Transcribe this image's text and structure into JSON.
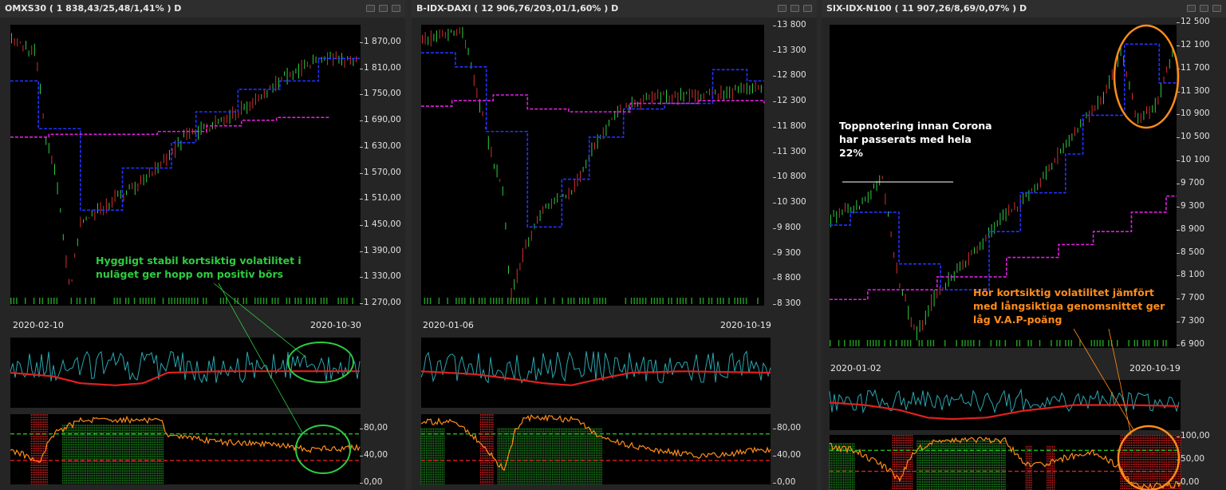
{
  "panes": [
    {
      "title": "OMXS30 ( 1 838,43/25,48/1,41% )  D",
      "price_axis": [
        "1 870,00",
        "1 810,00",
        "1 750,00",
        "1 690,00",
        "1 630,00",
        "1 570,00",
        "1 510,00",
        "1 450,00",
        "1 390,00",
        "1 330,00",
        "1 270,00"
      ],
      "date_start": "2020-02-10",
      "date_end": "2020-10-30",
      "osc_axis": [
        "80,00",
        "40,00",
        "0,00"
      ],
      "annotation": "Hyggligt stabil kortsiktig volatilitet i nuläget ger hopp om positiv börs"
    },
    {
      "title": "B-IDX-DAXI ( 12 906,76/203,01/1,60% )  D",
      "price_axis": [
        "13 800",
        "13 300",
        "12 800",
        "12 300",
        "11 800",
        "11 300",
        "10 800",
        "10 300",
        "9 800",
        "9 300",
        "8 800",
        "8 300"
      ],
      "date_start": "2020-01-06",
      "date_end": "2020-10-19",
      "osc_axis": [
        "80,00",
        "40,00",
        "0,00"
      ]
    },
    {
      "title": "SIX-IDX-N100 ( 11 907,26/8,69/0,07% )  D",
      "price_axis": [
        "12 500",
        "12 100",
        "11 700",
        "11 300",
        "10 900",
        "10 500",
        "10 100",
        "9 700",
        "9 300",
        "8 900",
        "8 500",
        "8 100",
        "7 700",
        "7 300",
        "6 900"
      ],
      "date_start": "2020-01-02",
      "date_end": "2020-10-19",
      "osc_axis": [
        "100,00",
        "50,00",
        "0,00"
      ],
      "annotation_top": "Toppnotering innan Corona har passerats med hela 22%",
      "annotation_bottom": "Hör kortsiktig volatilitet jämfört med långsiktiga genomsnittet ger låg V.A.P-poäng"
    }
  ],
  "colors": {
    "candle_up": "#2ecc40",
    "candle_down": "#d32f2f",
    "short_ma": "#2233ff",
    "long_ma": "#e020e0",
    "vol_line": "#2aa6b0",
    "vol_avg": "#e02020",
    "osc_line": "#ff8c1a",
    "annot_green": "#2ecc40",
    "annot_orange": "#ff8c1a",
    "annot_white": "#ffffff"
  }
}
